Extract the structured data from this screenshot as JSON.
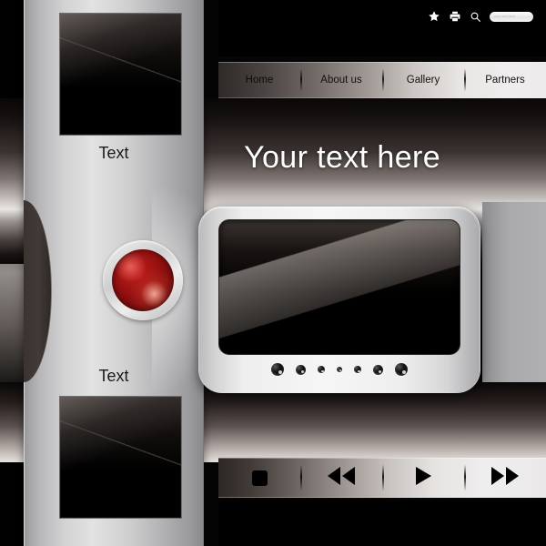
{
  "page": {
    "hero_text": "Your text here",
    "accent_color": "#8e0f0f",
    "silver_color": "#d2d2d3",
    "dark_color": "#000000"
  },
  "topbar": {
    "icons": [
      {
        "name": "star-icon",
        "label": "Favorites"
      },
      {
        "name": "printer-icon",
        "label": "Print"
      },
      {
        "name": "search-icon",
        "label": "Search"
      }
    ],
    "search": {
      "value": "",
      "placeholder": "your text here"
    }
  },
  "nav": {
    "items": [
      {
        "label": "Home"
      },
      {
        "label": "About us"
      },
      {
        "label": "Gallery"
      },
      {
        "label": "Partners"
      }
    ]
  },
  "sidebar": {
    "thumbnails": [
      {
        "label": "Text",
        "position": "top"
      },
      {
        "label": "Text",
        "position": "bottom"
      }
    ],
    "button": {
      "name": "red-round-button",
      "color": "#8e0f0f",
      "label": ""
    }
  },
  "panel": {
    "screen": {
      "label": ""
    },
    "dots": [
      {
        "size": "xl"
      },
      {
        "size": "lg"
      },
      {
        "size": "md"
      },
      {
        "size": "sm"
      },
      {
        "size": "md"
      },
      {
        "size": "lg"
      },
      {
        "size": "xl"
      }
    ]
  },
  "media_controls": [
    {
      "name": "stop-button",
      "glyph": "stop",
      "label": "Stop"
    },
    {
      "name": "rewind-button",
      "glyph": "rewind",
      "label": "Rewind"
    },
    {
      "name": "play-button",
      "glyph": "play",
      "label": "Play"
    },
    {
      "name": "fast-forward-button",
      "glyph": "forward",
      "label": "Fast forward"
    }
  ]
}
